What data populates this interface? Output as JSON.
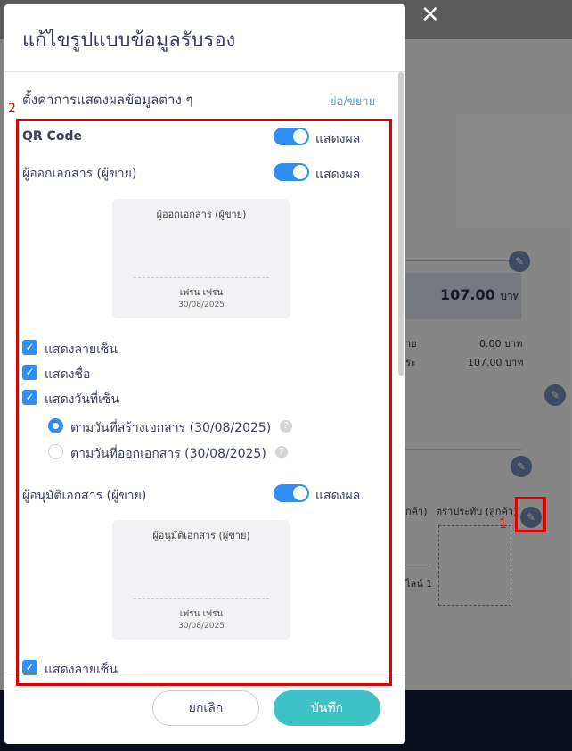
{
  "background": {
    "amount_value": "107.00",
    "amount_unit": "บาท",
    "rows": [
      {
        "label": "าย",
        "value": "0.00 บาท"
      },
      {
        "label": "ระ",
        "value": "107.00 บาท"
      }
    ],
    "col_buyer_tail": "กค้า)",
    "col_stamp": "ตราประทับ (ลูกค้า)",
    "online_tail": "ไลน์ 1"
  },
  "annotations": {
    "marker_1": "1",
    "marker_2": "2"
  },
  "modal": {
    "title": "แก้ไขรูปแบบข้อมูลรับรอง",
    "section_title": "ตั้งค่าการแสดงผลข้อมูลต่าง ๆ",
    "collapse_label": "ย่อ/ขยาย",
    "show_label": "แสดงผล",
    "qr": {
      "label": "QR Code",
      "enabled": true
    },
    "issuer": {
      "label": "ผู้ออกเอกสาร (ผู้ขาย)",
      "enabled": true,
      "card_title": "ผู้ออกเอกสาร (ผู้ขาย)",
      "card_name": "เฟรน เฟรน",
      "card_date": "30/08/2025",
      "options": [
        {
          "label": "แสดงลายเซ็น",
          "checked": true
        },
        {
          "label": "แสดงชื่อ",
          "checked": true
        },
        {
          "label": "แสดงวันที่เซ็น",
          "checked": true
        }
      ],
      "date_options": [
        {
          "label": "ตามวันที่สร้างเอกสาร (30/08/2025)",
          "selected": true
        },
        {
          "label": "ตามวันที่ออกเอกสาร (30/08/2025)",
          "selected": false
        }
      ]
    },
    "approver": {
      "label": "ผู้อนุมัติเอกสาร (ผู้ขาย)",
      "enabled": true,
      "card_title": "ผู้อนุมัติเอกสาร (ผู้ขาย)",
      "card_name": "เฟรน เฟรน",
      "card_date": "30/08/2025",
      "options": [
        {
          "label": "แสดงลายเซ็น",
          "checked": true
        }
      ]
    },
    "cancel_label": "ยกเลิก",
    "save_label": "บันทึก",
    "check_glyph": "✓",
    "help_glyph": "?",
    "close_glyph": "✕",
    "edit_glyph": "✎"
  },
  "colors": {
    "accent": "#2f8ef5",
    "save": "#3ec1c7",
    "highlight": "#e00000"
  }
}
